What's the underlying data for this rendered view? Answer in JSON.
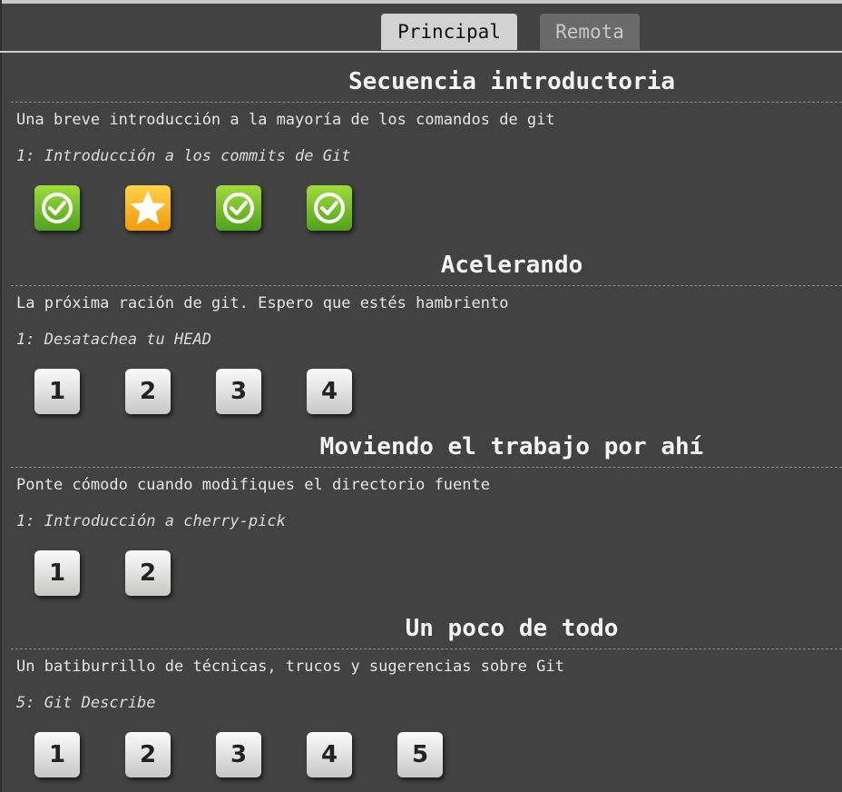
{
  "tabs": [
    {
      "label": "Principal",
      "active": true
    },
    {
      "label": "Remota",
      "active": false
    }
  ],
  "sections": [
    {
      "title": "Secuencia introductoria",
      "description": "Una breve introducción a la mayoría de los comandos de git",
      "current_level": "1: Introducción a los commits de Git",
      "levels": [
        {
          "icon": "check-icon",
          "status": "completed"
        },
        {
          "icon": "star-icon",
          "status": "current"
        },
        {
          "icon": "check-icon",
          "status": "completed"
        },
        {
          "icon": "check-icon",
          "status": "completed"
        }
      ]
    },
    {
      "title": "Acelerando",
      "description": "La próxima ración de git. Espero que estés hambriento",
      "current_level": "1: Desatachea tu HEAD",
      "levels": [
        {
          "label": "1"
        },
        {
          "label": "2"
        },
        {
          "label": "3"
        },
        {
          "label": "4"
        }
      ]
    },
    {
      "title": "Moviendo el trabajo por ahí",
      "description": "Ponte cómodo cuando modifiques el directorio fuente",
      "current_level": "1: Introducción a cherry-pick",
      "levels": [
        {
          "label": "1"
        },
        {
          "label": "2"
        }
      ]
    },
    {
      "title": "Un poco de todo",
      "description": "Un batiburrillo de técnicas, trucos y sugerencias sobre Git",
      "current_level": "5: Git Describe",
      "levels": [
        {
          "label": "1"
        },
        {
          "label": "2"
        },
        {
          "label": "3"
        },
        {
          "label": "4"
        },
        {
          "label": "5"
        }
      ]
    }
  ],
  "colors": {
    "background": "#424242",
    "completed": "#6abf2a",
    "current": "#f5a623",
    "level_button": "#e2e3e1"
  }
}
